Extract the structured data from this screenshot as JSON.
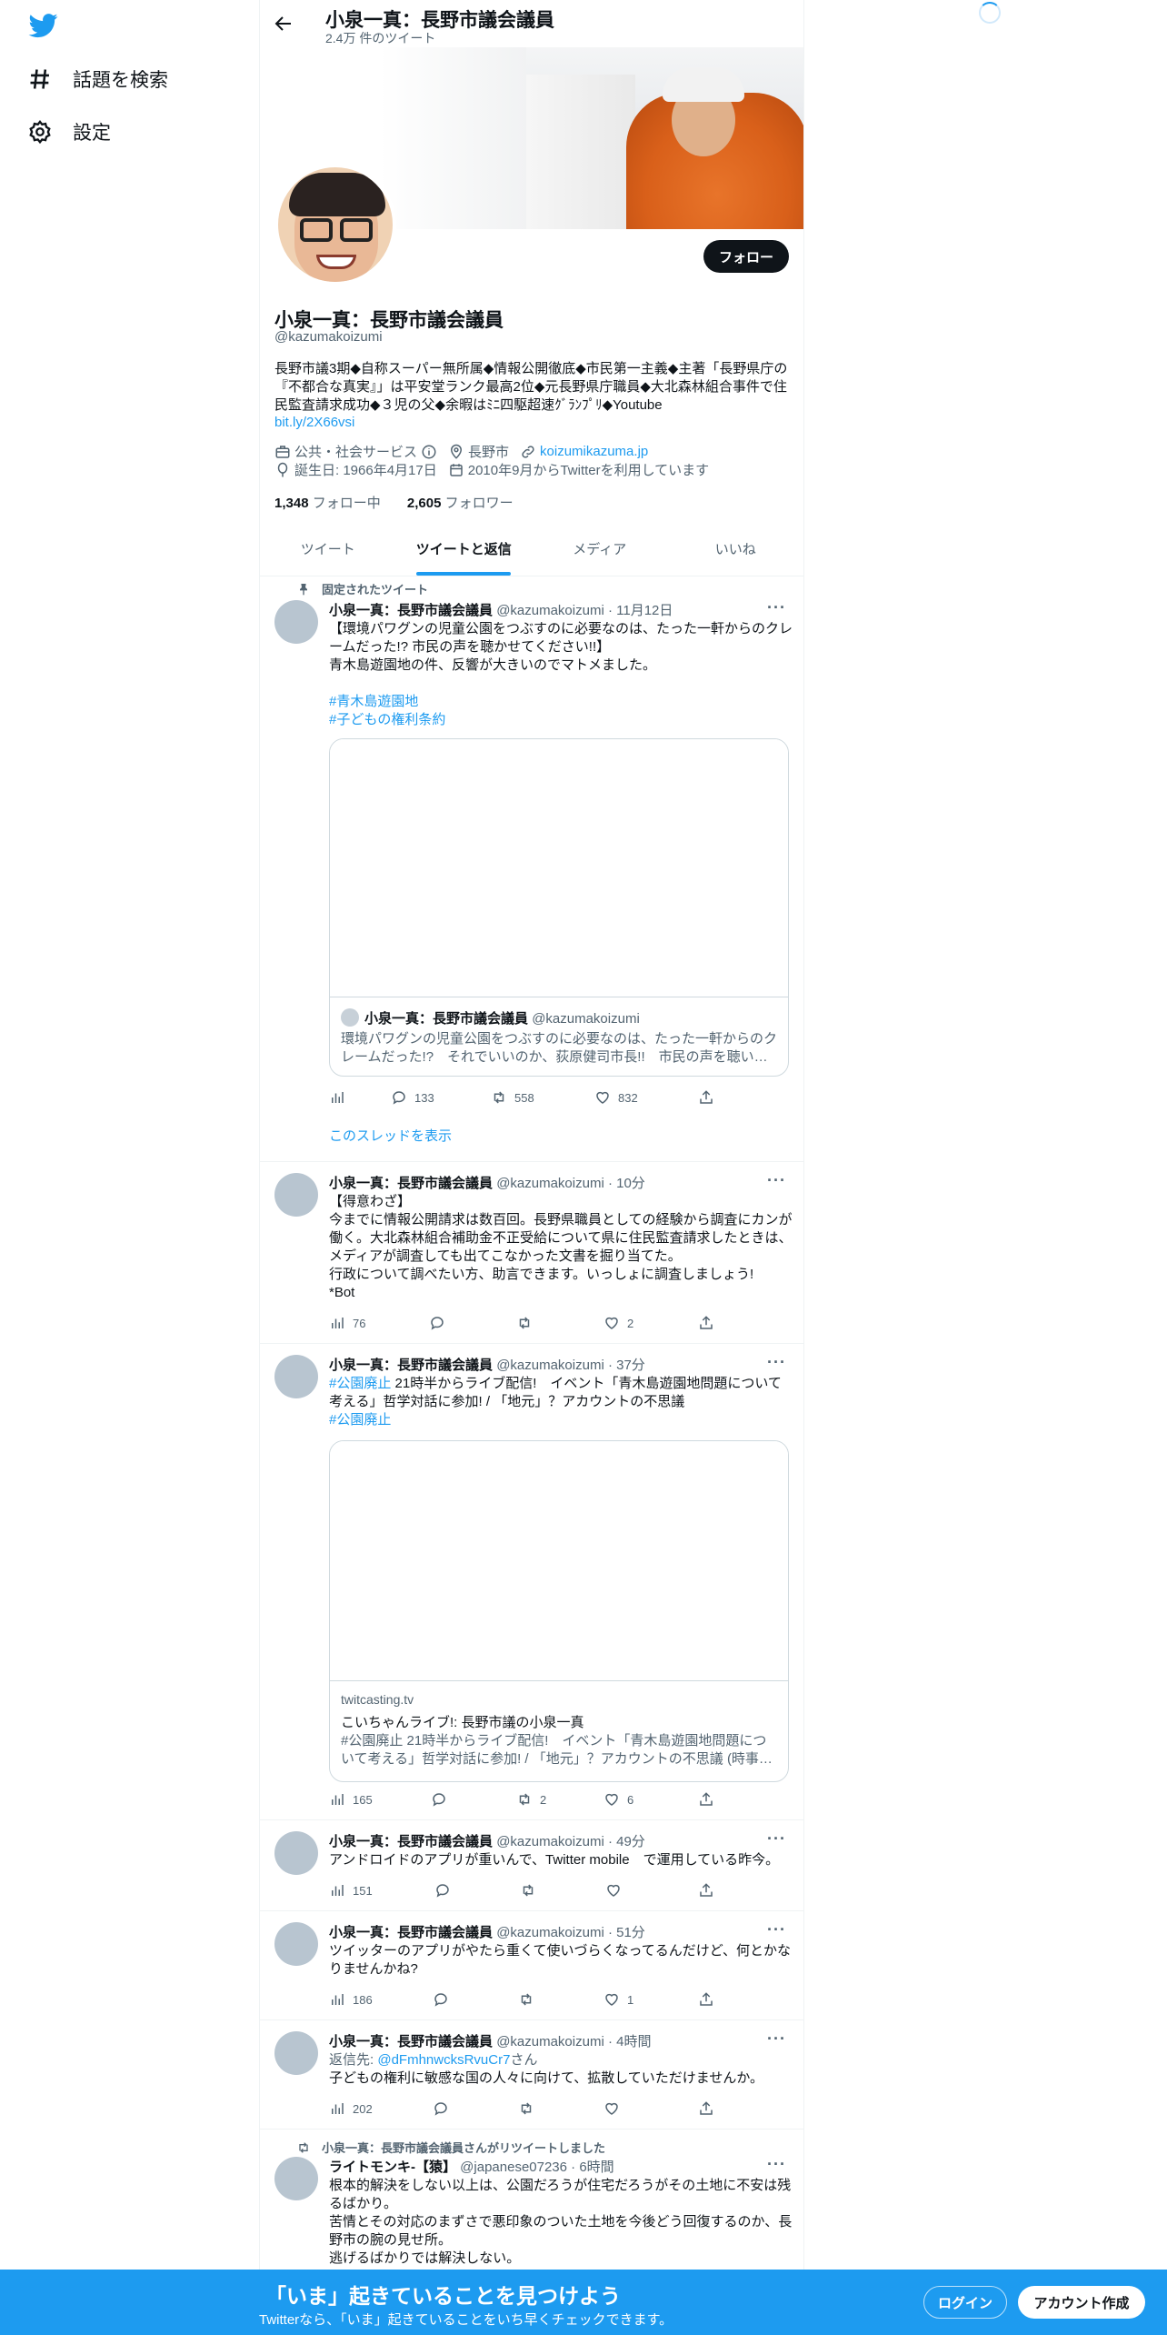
{
  "sidebar": {
    "items": [
      {
        "label": "話題を検索",
        "icon": "hashtag-icon"
      },
      {
        "label": "設定",
        "icon": "gear-icon"
      }
    ]
  },
  "header": {
    "name": "小泉一真：長野市議会議員",
    "tweet_count": "2.4万 件のツイート"
  },
  "profile": {
    "name": "小泉一真：長野市議会議員",
    "handle": "@kazumakoizumi",
    "follow_label": "フォロー",
    "bio": "長野市議3期◆自称スーパー無所属◆情報公開徹底◆市民第一主義◆主著「長野県庁の『不都合な真実』」は平安堂ランク最高2位◆元長野県庁職員◆大北森林組合事件で住民監査請求成功◆３児の父◆余暇はﾐﾆ四駆超速ｸﾞﾗﾝﾌﾟﾘ◆Youtube",
    "bio_link": "bit.ly/2X66vsi",
    "category": "公共・社会サービス",
    "location": "長野市",
    "website": "koizumikazuma.jp",
    "birthday": "誕生日: 1966年4月17日",
    "joined": "2010年9月からTwitterを利用しています",
    "following_count": "1,348",
    "following_label": "フォロー中",
    "followers_count": "2,605",
    "followers_label": "フォロワー"
  },
  "tabs": [
    {
      "label": "ツイート"
    },
    {
      "label": "ツイートと返信"
    },
    {
      "label": "メディア"
    },
    {
      "label": "いいね"
    }
  ],
  "pinned_label": "固定されたツイート",
  "tweets": [
    {
      "name": "小泉一真：長野市議会議員",
      "handle": "@kazumakoizumi",
      "time": "11月12日",
      "text1": "【環境パワグンの児童公園をつぶすのに必要なのは、たった一軒からのクレームだった!? 市民の声を聴かせてください!!】",
      "text2": "青木島遊園地の件、反響が大きいのでマトメました。",
      "tag1": "#青木島遊園地",
      "tag2": "#子どもの権利条約",
      "quote_name": "小泉一真：長野市議会議員",
      "quote_handle": "@kazumakoizumi",
      "quote_text": "環境パワグンの児童公園をつぶすのに必要なのは、たった一軒からのクレームだった!?　それでいいのか、荻原健司市長!!　市民の声を聴い…",
      "replies": "133",
      "retweets": "558",
      "likes": "832",
      "thread_link": "このスレッドを表示"
    },
    {
      "name": "小泉一真：長野市議会議員",
      "handle": "@kazumakoizumi",
      "time": "10分",
      "text": "【得意わざ】\n今までに情報公開請求は数百回。長野県職員としての経験から調査にカンが働く。大北森林組合補助金不正受給について県に住民監査請求したときは、メディアが調査しても出てこなかった文書を掘り当てた。\n行政について調べたい方、助言できます。いっしょに調査しましょう!\n*Bot",
      "views": "76",
      "likes": "2"
    },
    {
      "name": "小泉一真：長野市議会議員",
      "handle": "@kazumakoizumi",
      "time": "37分",
      "tag": "#公園廃止",
      "text": " 21時半からライブ配信!　イベント「青木島遊園地問題について考える」哲学対話に参加! / 「地元」？アカウントの不思議",
      "tag2": "#公園廃止",
      "card_domain": "twitcasting.tv",
      "card_title": "こいちゃんライブ!: 長野市議の小泉一真",
      "card_desc": "#公園廃止 21時半からライブ配信!　イベント「青木島遊園地問題について考える」哲学対話に参加! / 「地元」？アカウントの不思議 (時事…",
      "views": "165",
      "retweets": "2",
      "likes": "6"
    },
    {
      "name": "小泉一真：長野市議会議員",
      "handle": "@kazumakoizumi",
      "time": "49分",
      "text": "アンドロイドのアプリが重いんで、Twitter mobile　で運用している昨今。",
      "views": "151"
    },
    {
      "name": "小泉一真：長野市議会議員",
      "handle": "@kazumakoizumi",
      "time": "51分",
      "text": "ツイッターのアプリがやたら重くて使いづらくなってるんだけど、何とかなりませんかね?",
      "views": "186",
      "likes": "1"
    },
    {
      "name": "小泉一真：長野市議会議員",
      "handle": "@kazumakoizumi",
      "time": "4時間",
      "reply_prefix": "返信先:",
      "reply_to": "@dFmhnwcksRvuCr7",
      "reply_suffix": "さん",
      "text": "子どもの権利に敏感な国の人々に向けて、拡散していただけませんか。",
      "views": "202"
    },
    {
      "retweet_label": "小泉一真：長野市議会議員さんがリツイートしました",
      "name": "ライトモンキ-【猿】",
      "handle": "@japanese07236",
      "time": "6時間",
      "text": "根本的解決をしない以上は、公園だろうが住宅だろうがその土地に不安は残るばかり。\n苦情とその対応のまずさで悪印象のついた土地を今後どう回復するのか、長野市の腕の見せ所。\n逃げるばかりでは解決しない。"
    }
  ],
  "bottom_bar": {
    "title": "「いま」起きていることを見つけよう",
    "subtitle": "Twitterなら、「いま」起きていることをいち早くチェックできます。",
    "login": "ログイン",
    "signup": "アカウント作成"
  },
  "colors": {
    "accent": "#1d9bf0",
    "text": "#0f1419",
    "secondary": "#536471"
  }
}
